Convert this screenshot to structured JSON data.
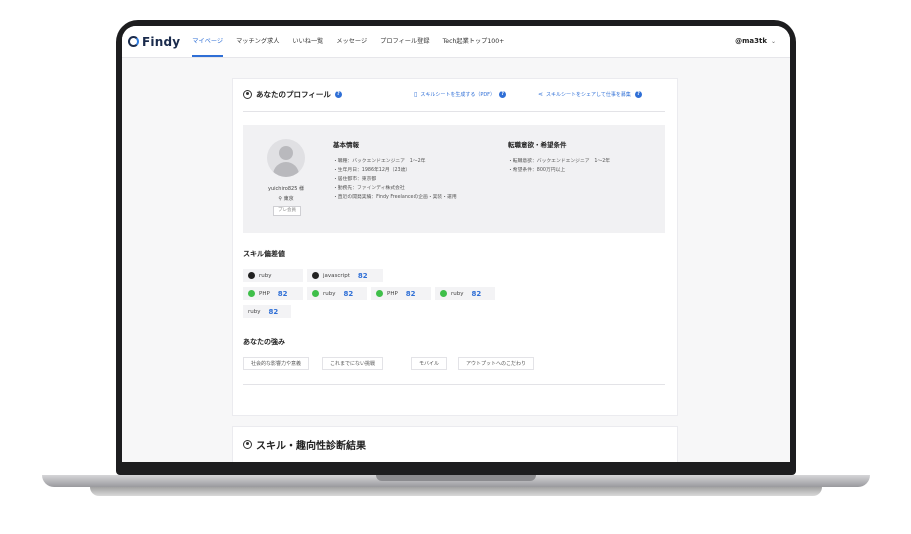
{
  "nav": {
    "logo": "Findy",
    "items": [
      "マイページ",
      "マッチング求人",
      "いいね一覧",
      "メッセージ",
      "プロフィール登録",
      "Tech起業トップ100+"
    ],
    "active_index": 0,
    "user": "@ma3tk",
    "user_chevron": "⌄"
  },
  "profile_section": {
    "title": "あなたのプロフィール",
    "help_icon": "?",
    "pdf_link": "スキルシートを生成する（PDF）",
    "share_link": "スキルシートをシェアして仕事を募集"
  },
  "profile": {
    "username": "yuichiro825 様",
    "location": "東京",
    "badge": "プレ会員"
  },
  "basic_info": {
    "title": "基本情報",
    "lines": [
      "・職種：バックエンドエンジニア　1〜2年",
      "・生年月日：1986年12月（23歳）",
      "・居住都市：東京都",
      "・勤務先：ファインディ株式会社",
      "・直近の開発実績：Findy Freelanceの企画・実装・運用"
    ]
  },
  "job_intent": {
    "title": "転職意欲・希望条件",
    "lines": [
      "・転職意欲：バックエンドエンジニア　1〜2年",
      "・希望条件：800万円以上"
    ]
  },
  "skills": {
    "title": "スキル偏差値",
    "rows": [
      [
        {
          "icon": "github-icon",
          "label": "ruby",
          "value": ""
        },
        {
          "icon": "github-icon",
          "label": "javascript",
          "value": "82"
        }
      ],
      [
        {
          "icon": "php-icon",
          "label": "PHP",
          "value": "82"
        },
        {
          "icon": "php-icon",
          "label": "ruby",
          "value": "82"
        },
        {
          "icon": "php-icon",
          "label": "PHP",
          "value": "82"
        },
        {
          "icon": "php-icon",
          "label": "ruby",
          "value": "82"
        }
      ],
      [
        {
          "icon": "",
          "label": "ruby",
          "value": "82"
        }
      ]
    ]
  },
  "strengths": {
    "title": "あなたの強み",
    "tags": [
      "社会的な影響力や意義",
      "これまでにない挑戦",
      "モバイル",
      "アウトプットへのこだわり"
    ]
  },
  "diagnosis": {
    "title": "スキル・趣向性診断結果"
  },
  "colors": {
    "accent": "#2f6fd6",
    "php_green": "#3fbf4a",
    "laptop_frame": "#1d1d1f"
  }
}
